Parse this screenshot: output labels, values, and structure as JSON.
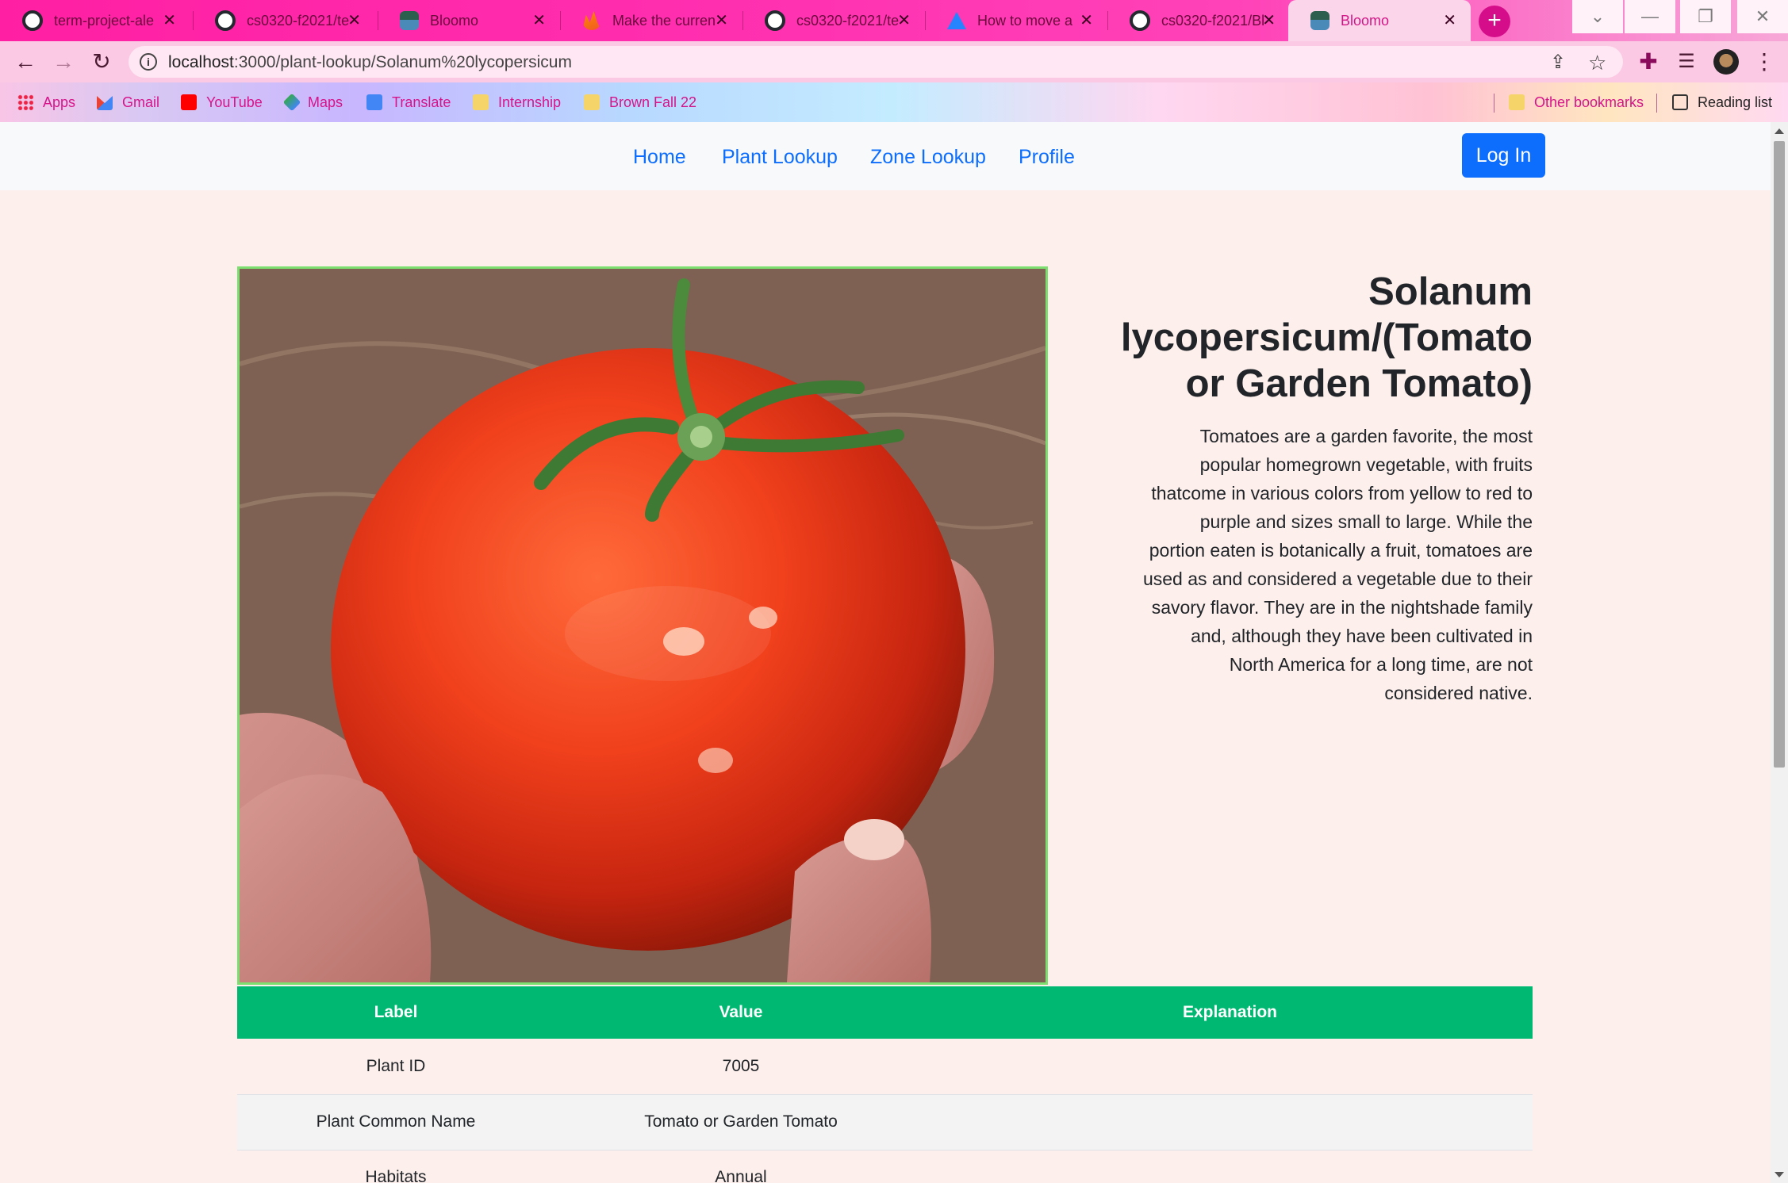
{
  "browser": {
    "tabs": [
      {
        "title": "term-project-ale",
        "icon": "github-icon",
        "active": false
      },
      {
        "title": "cs0320-f2021/te",
        "icon": "github-icon",
        "active": false
      },
      {
        "title": "Bloomo",
        "icon": "bloomo-icon",
        "active": false
      },
      {
        "title": "Make the curren",
        "icon": "stackoverflow-icon",
        "active": false
      },
      {
        "title": "cs0320-f2021/te",
        "icon": "github-icon",
        "active": false
      },
      {
        "title": "How to move a",
        "icon": "atlassian-icon",
        "active": false
      },
      {
        "title": "cs0320-f2021/Bl",
        "icon": "github-icon",
        "active": false
      },
      {
        "title": "Bloomo",
        "icon": "bloomo-icon",
        "active": true
      }
    ],
    "url_host": "localhost",
    "url_path": ":3000/plant-lookup/Solanum%20lycopersicum",
    "bookmarks": [
      "Apps",
      "Gmail",
      "YouTube",
      "Maps",
      "Translate",
      "Internship",
      "Brown Fall 22"
    ],
    "other_bookmarks": "Other bookmarks",
    "reading_list": "Reading list"
  },
  "nav": {
    "links": [
      "Home",
      "Plant Lookup",
      "Zone Lookup",
      "Profile"
    ],
    "login": "Log In"
  },
  "plant": {
    "title": "Solanum lycopersicum/(Tomato or Garden Tomato)",
    "description": "Tomatoes are a garden favorite, the most popular homegrown vegetable, with fruits thatcome in various colors from yellow to red to purple and sizes small to large. While the portion eaten is botanically a fruit, tomatoes are used as and considered a vegetable due to their savory flavor. They are in the nightshade family and, although they have been cultivated in North America for a long time, are not considered native."
  },
  "table": {
    "headers": [
      "Label",
      "Value",
      "Explanation"
    ],
    "rows": [
      {
        "label": "Plant ID",
        "value": "7005",
        "explanation": ""
      },
      {
        "label": "Plant Common Name",
        "value": "Tomato or Garden Tomato",
        "explanation": ""
      },
      {
        "label": "Habitats",
        "value": "Annual",
        "explanation": ""
      }
    ]
  },
  "colors": {
    "tab_bar": "#ff2fb0",
    "link": "#0d6efd",
    "table_header": "#00b871",
    "image_border": "#7ddf6f"
  }
}
